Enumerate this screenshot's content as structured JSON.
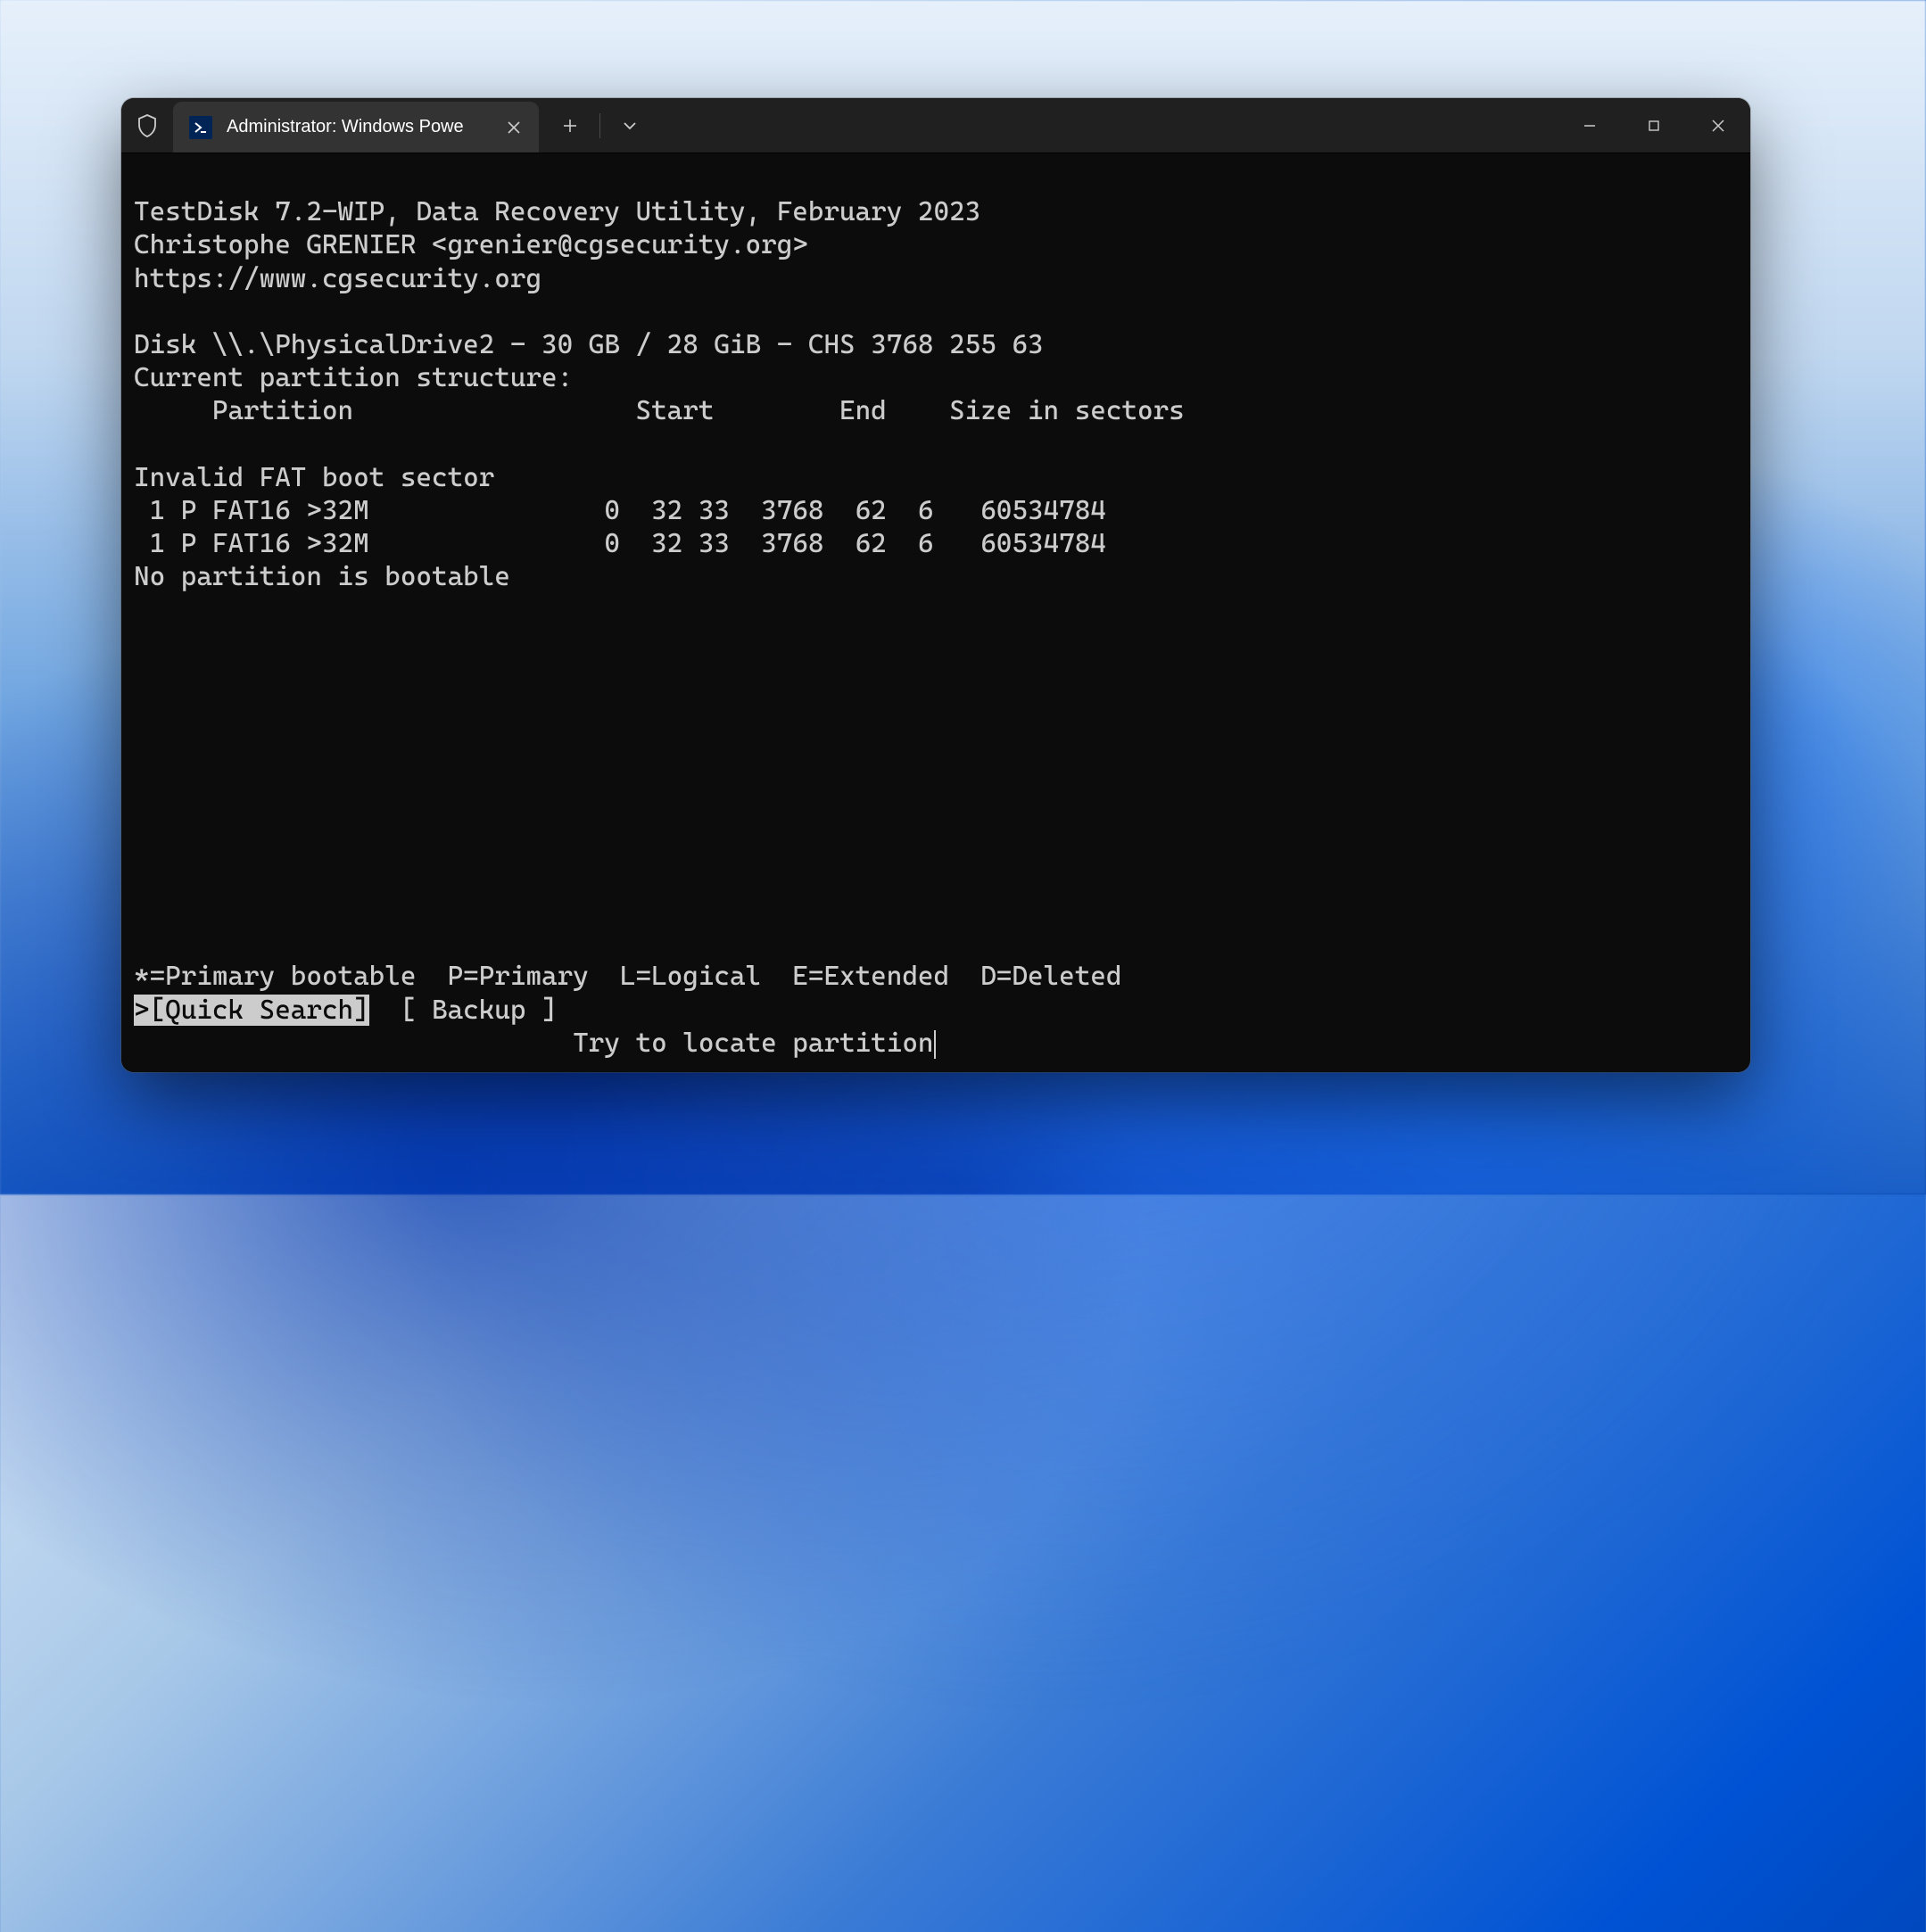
{
  "titlebar": {
    "tab_title": "Administrator: Windows Powe",
    "shield_icon": "shield-icon",
    "ps_icon_text": ">_"
  },
  "terminal": {
    "line1": "TestDisk 7.2-WIP, Data Recovery Utility, February 2023",
    "line2": "Christophe GRENIER <grenier@cgsecurity.org>",
    "line3": "https://www.cgsecurity.org",
    "line4": "",
    "line5": "Disk \\\\.\\PhysicalDrive2 - 30 GB / 28 GiB - CHS 3768 255 63",
    "line6": "Current partition structure:",
    "line7": "     Partition                  Start        End    Size in sectors",
    "line8": "",
    "line9": "Invalid FAT boot sector",
    "line10": " 1 P FAT16 >32M               0  32 33  3768  62  6   60534784",
    "line11": " 1 P FAT16 >32M               0  32 33  3768  62  6   60534784",
    "line12": "No partition is bootable",
    "legend": "*=Primary bootable  P=Primary  L=Logical  E=Extended  D=Deleted",
    "menu_selected": ">[Quick Search]",
    "menu_gap": "  ",
    "menu_backup": "[ Backup ]",
    "hint_prefix": "                            ",
    "hint": "Try to locate partition"
  }
}
